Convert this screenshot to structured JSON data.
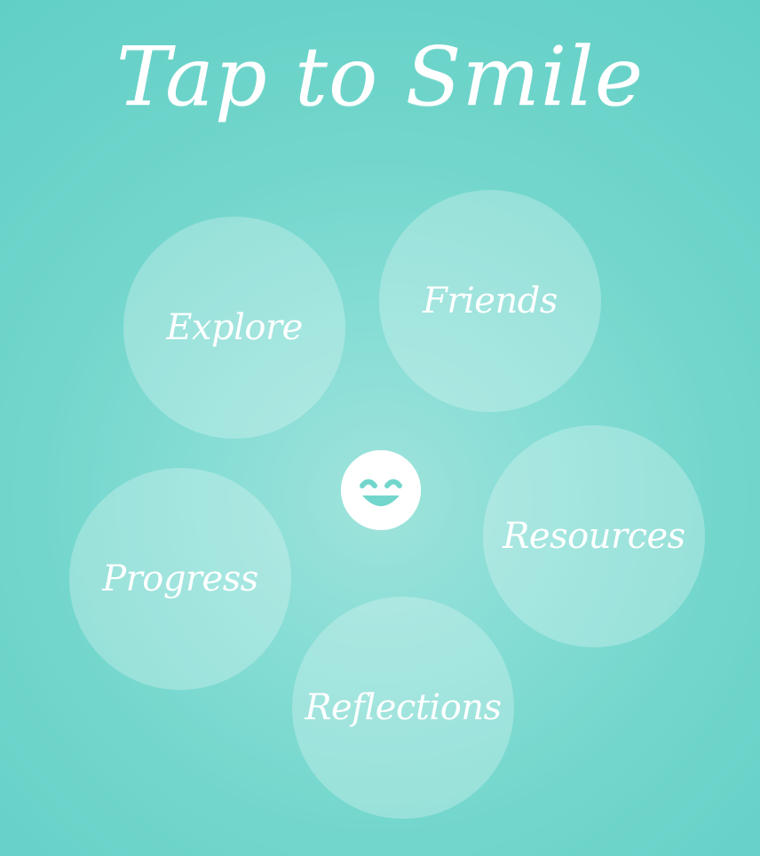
{
  "app": {
    "title": "Tap to Smile"
  },
  "bubbles": [
    {
      "label": "Explore"
    },
    {
      "label": "Friends"
    },
    {
      "label": "Progress"
    },
    {
      "label": "Resources"
    },
    {
      "label": "Reflections"
    }
  ],
  "center_button": {
    "icon": "smile-icon"
  },
  "colors": {
    "background": "#72d6cc",
    "accent": "#ffffff",
    "bubble": "rgba(255,255,255,0.26)"
  }
}
